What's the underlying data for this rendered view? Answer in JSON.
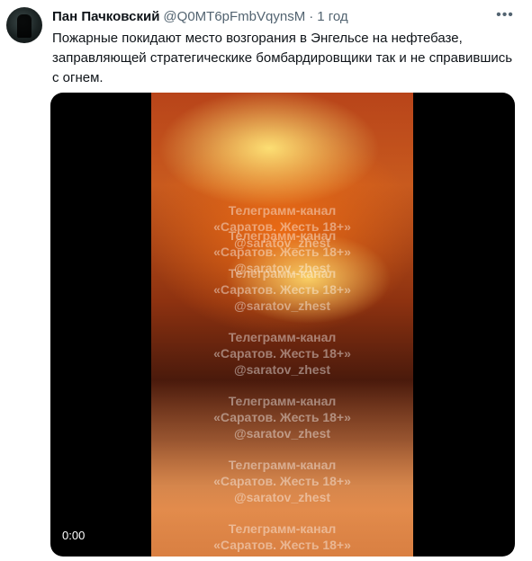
{
  "author": {
    "name": "Пан Пачковский",
    "handle": "@Q0MT6pFmbVqynsM",
    "separator": "·",
    "time": "1 год"
  },
  "menu_icon": "more-dots-icon",
  "tweet_text": "Пожарные покидают место возгорания в Энгельсе на нефтебазе, заправляющей стратегическике бомбардировщики так и не справившись с огнем.",
  "media": {
    "video_time": "0:00",
    "watermark": {
      "line1": "Телеграмм-канал",
      "line2": "«Саратов. Жесть 18+»",
      "line3": "@saratov_zhest"
    }
  }
}
